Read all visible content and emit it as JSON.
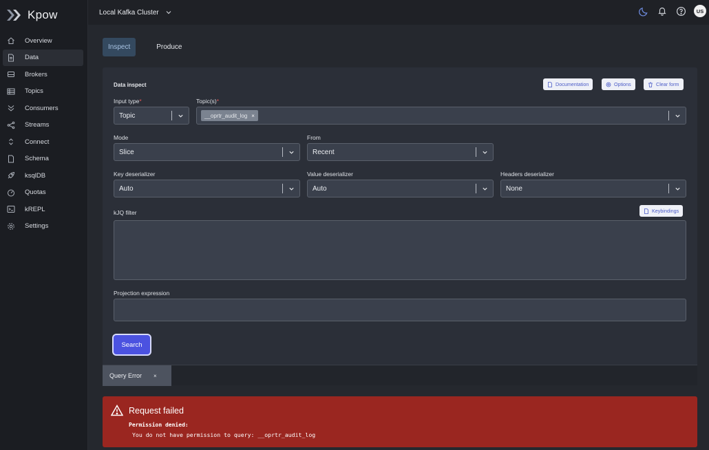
{
  "app": {
    "name": "Kpow"
  },
  "sidebar": {
    "items": [
      {
        "label": "Overview",
        "icon": "home-icon"
      },
      {
        "label": "Data",
        "icon": "document-icon",
        "active": true
      },
      {
        "label": "Brokers",
        "icon": "server-icon"
      },
      {
        "label": "Topics",
        "icon": "table-icon"
      },
      {
        "label": "Consumers",
        "icon": "chevrons-down-icon"
      },
      {
        "label": "Streams",
        "icon": "share-icon"
      },
      {
        "label": "Connect",
        "icon": "chevrons-up-down-icon"
      },
      {
        "label": "Schema",
        "icon": "file-icon"
      },
      {
        "label": "ksqlDB",
        "icon": "rocket-icon"
      },
      {
        "label": "Quotas",
        "icon": "gauge-icon"
      },
      {
        "label": "kREPL",
        "icon": "terminal-icon"
      },
      {
        "label": "Settings",
        "icon": "gear-icon"
      }
    ]
  },
  "header": {
    "cluster": "Local Kafka Cluster",
    "avatar_initials": "US",
    "icons": [
      "moon-icon",
      "bell-icon",
      "help-icon"
    ]
  },
  "tabs": [
    {
      "label": "Inspect",
      "active": true
    },
    {
      "label": "Produce",
      "active": false
    }
  ],
  "form": {
    "title": "Data inspect",
    "buttons": {
      "documentation": "Documentation",
      "options": "Options",
      "clear": "Clear form",
      "keybindings": "Keybindings"
    },
    "input_type": {
      "label": "Input type",
      "required_mark": "*",
      "value": "Topic"
    },
    "topics": {
      "label": "Topic(s)",
      "required_mark": "*",
      "tag": "__oprtr_audit_log",
      "tag_remove": "×"
    },
    "mode": {
      "label": "Mode",
      "value": "Slice"
    },
    "from": {
      "label": "From",
      "value": "Recent"
    },
    "key_deserializer": {
      "label": "Key deserializer",
      "value": "Auto"
    },
    "value_deserializer": {
      "label": "Value deserializer",
      "value": "Auto"
    },
    "headers_deserializer": {
      "label": "Headers deserializer",
      "value": "None"
    },
    "kjq_filter": {
      "label": "kJQ filter"
    },
    "projection": {
      "label": "Projection expression"
    },
    "search": "Search"
  },
  "result_tab": {
    "label": "Query Error",
    "close": "×"
  },
  "error": {
    "title": "Request failed",
    "line1": "Permission denied:",
    "line2": "You do not have permission to query: __oprtr_audit_log"
  },
  "colors": {
    "accent": "#4b52e0",
    "error_bg": "#9a2620",
    "active_tab": "#34495f"
  }
}
